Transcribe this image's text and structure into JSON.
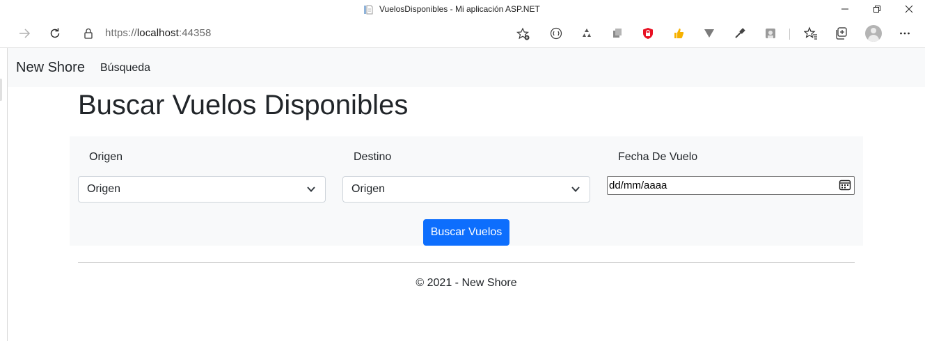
{
  "window": {
    "title": "VuelosDisponibles - Mi aplicación ASP.NET",
    "favicon": "document-icon"
  },
  "browser": {
    "url_scheme": "https://",
    "url_host": "localhost",
    "url_port": ":44358",
    "extensions": [
      "immersive-reader-icon",
      "recycle-icon",
      "copy-icon",
      "shield-icon",
      "thumb-icon",
      "funnel-icon",
      "eyedropper-icon",
      "photo-icon"
    ],
    "toolbar_icons": [
      "favorites-icon",
      "collections-icon",
      "profile-avatar",
      "more-icon"
    ]
  },
  "app": {
    "brand": "New Shore",
    "nav": {
      "search": "Búsqueda"
    }
  },
  "page": {
    "title": "Buscar Vuelos Disponibles"
  },
  "form": {
    "origin": {
      "label": "Origen",
      "selected": "Origen"
    },
    "destination": {
      "label": "Destino",
      "selected": "Origen"
    },
    "date": {
      "label": "Fecha De Vuelo",
      "value": "dd/mm/aaaa"
    },
    "submit": "Buscar Vuelos"
  },
  "footer": {
    "text": "© 2021 - New Shore"
  },
  "colors": {
    "primary": "#0d6efd",
    "nav_bg": "#f8f9fa",
    "text": "#212529",
    "shield": "#e81123",
    "thumb": "#f6b100"
  }
}
